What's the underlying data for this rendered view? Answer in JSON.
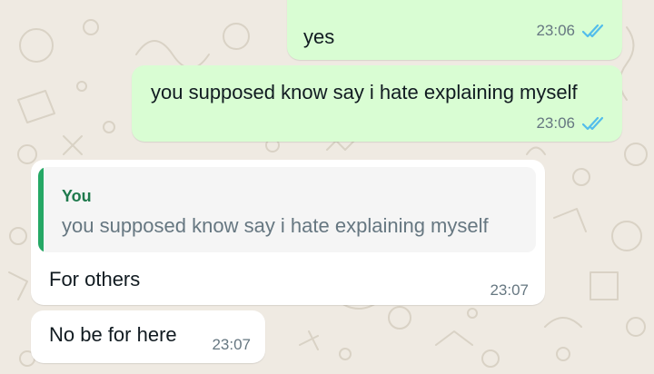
{
  "colors": {
    "chat_background": "#efeae2",
    "outgoing_bubble": "#d9fdd3",
    "incoming_bubble": "#ffffff",
    "read_ticks": "#53bdeb",
    "quote_accent": "#25a865"
  },
  "messages": [
    {
      "direction": "outgoing",
      "text": "yes",
      "time": "23:06",
      "status": "read",
      "status_icon": "double-check-icon"
    },
    {
      "direction": "outgoing",
      "text": "you supposed know say i hate explaining myself",
      "time": "23:06",
      "status": "read",
      "status_icon": "double-check-icon"
    },
    {
      "direction": "incoming",
      "quoted": {
        "author": "You",
        "text": "you supposed know say i hate explaining myself"
      },
      "text": "For others",
      "time": "23:07"
    },
    {
      "direction": "incoming",
      "text": "No be for here",
      "time": "23:07"
    }
  ]
}
